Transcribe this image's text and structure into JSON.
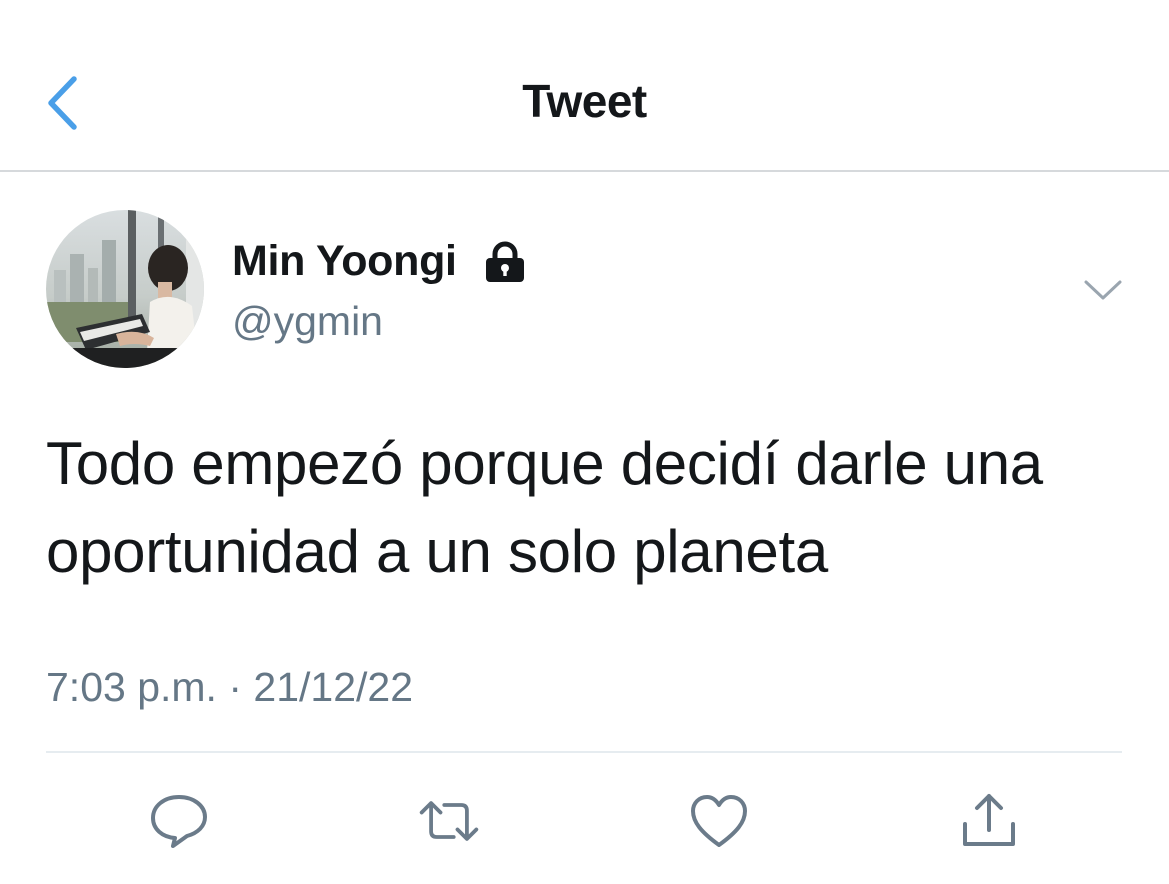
{
  "header": {
    "title": "Tweet",
    "back_icon": "chevron-left-icon"
  },
  "tweet": {
    "author": {
      "display_name": "Min Yoongi",
      "handle": "@ygmin",
      "protected_icon": "lock-icon"
    },
    "text": "Todo empezó porque decidí darle una oportunidad a un solo planeta",
    "time": "7:03 p.m.",
    "separator": "·",
    "date": "21/12/22"
  },
  "actions": [
    "reply-icon",
    "retweet-icon",
    "like-icon",
    "share-icon"
  ],
  "colors": {
    "accent": "#4a9fe8",
    "text": "#14171a",
    "secondary": "#657786",
    "border": "#d6d9dc"
  }
}
